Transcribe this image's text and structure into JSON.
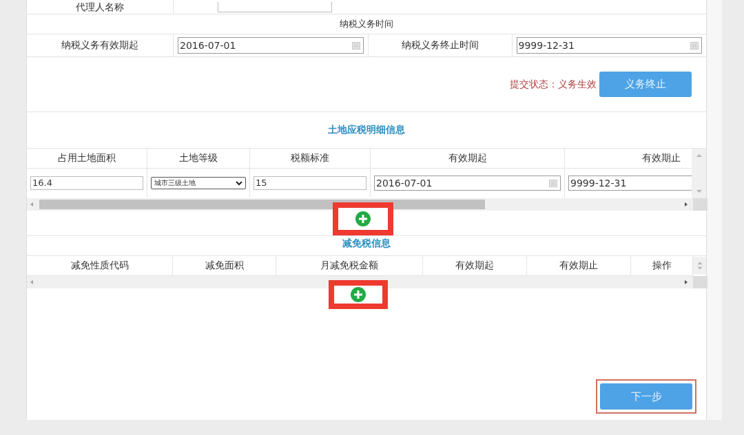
{
  "agent_row": {
    "label": "代理人名称"
  },
  "obligation_period": {
    "title": "纳税义务时间",
    "start_label": "纳税义务有效期起",
    "start_value": "2016-07-01",
    "end_label": "纳税义务终止时间",
    "end_value": "9999-12-31"
  },
  "status": {
    "text": "提交状态：义务生效",
    "button": "义务终止"
  },
  "land_details": {
    "title": "土地应税明细信息",
    "columns": [
      "占用土地面积",
      "土地等级",
      "税额标准",
      "有效期起",
      "有效期止"
    ],
    "rows": [
      {
        "cells": [
          {
            "kind": "text",
            "value": "16.4"
          },
          {
            "kind": "select",
            "value": "城市三级土地"
          },
          {
            "kind": "text",
            "value": "15"
          },
          {
            "kind": "date",
            "value": "2016-07-01"
          },
          {
            "kind": "date",
            "value": "9999-12-31"
          }
        ]
      }
    ],
    "add_highlighted": true
  },
  "exemption": {
    "title": "减免税信息",
    "columns": [
      "减免性质代码",
      "减免面积",
      "月减免税金额",
      "有效期起",
      "有效期止",
      "操作"
    ],
    "add_highlighted": true
  },
  "next_button": {
    "label": "下一步",
    "highlighted": true
  }
}
